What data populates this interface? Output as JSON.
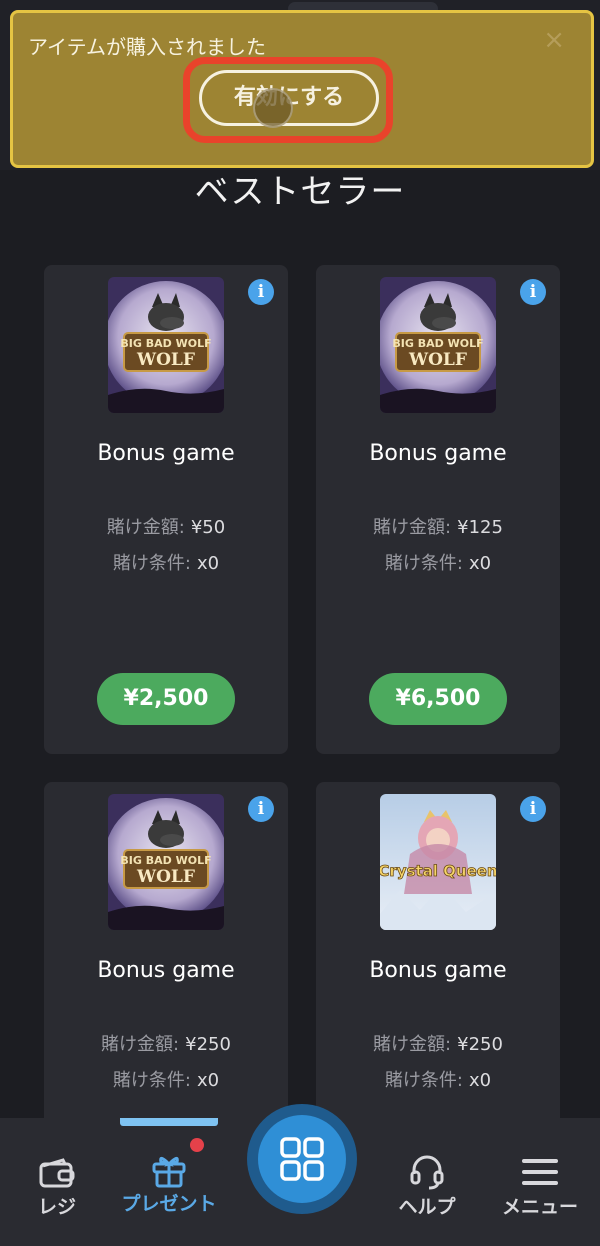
{
  "banner": {
    "message": "アイテムが購入されました",
    "close_glyph": "×",
    "activate_label": "有効にする"
  },
  "section": {
    "title": "ベストセラー"
  },
  "cards": [
    {
      "game": "BIG BAD WOLF",
      "title": "Bonus game",
      "bet_label": "賭け金額:",
      "bet_value": "¥50",
      "cond_label": "賭け条件:",
      "cond_value": "x0",
      "price": "¥2,500",
      "info": "i"
    },
    {
      "game": "BIG BAD WOLF",
      "title": "Bonus game",
      "bet_label": "賭け金額:",
      "bet_value": "¥125",
      "cond_label": "賭け条件:",
      "cond_value": "x0",
      "price": "¥6,500",
      "info": "i"
    },
    {
      "game": "BIG BAD WOLF",
      "title": "Bonus game",
      "bet_label": "賭け金額:",
      "bet_value": "¥250",
      "cond_label": "賭け条件:",
      "cond_value": "x0",
      "info": "i"
    },
    {
      "game": "Crystal Queen",
      "title": "Bonus game",
      "bet_label": "賭け金額:",
      "bet_value": "¥250",
      "cond_label": "賭け条件:",
      "cond_value": "x0",
      "info": "i"
    }
  ],
  "nav": {
    "items": [
      {
        "label": "レジ",
        "icon": "wallet-icon"
      },
      {
        "label": "プレゼント",
        "icon": "gift-icon",
        "active": true
      },
      {
        "label": "",
        "icon": "grid-icon"
      },
      {
        "label": "ヘルプ",
        "icon": "headset-icon"
      },
      {
        "label": "メニュー",
        "icon": "hamburger-icon"
      }
    ]
  },
  "colors": {
    "background": "#1c1d22",
    "card": "#2a2b31",
    "banner": "#9d8433",
    "banner_border": "#e5c443",
    "highlight": "#e9432b",
    "price_green": "#4caa5e",
    "accent_blue": "#2f8fd6",
    "nav_active": "#7fc3f2",
    "notification": "#e5414a"
  }
}
